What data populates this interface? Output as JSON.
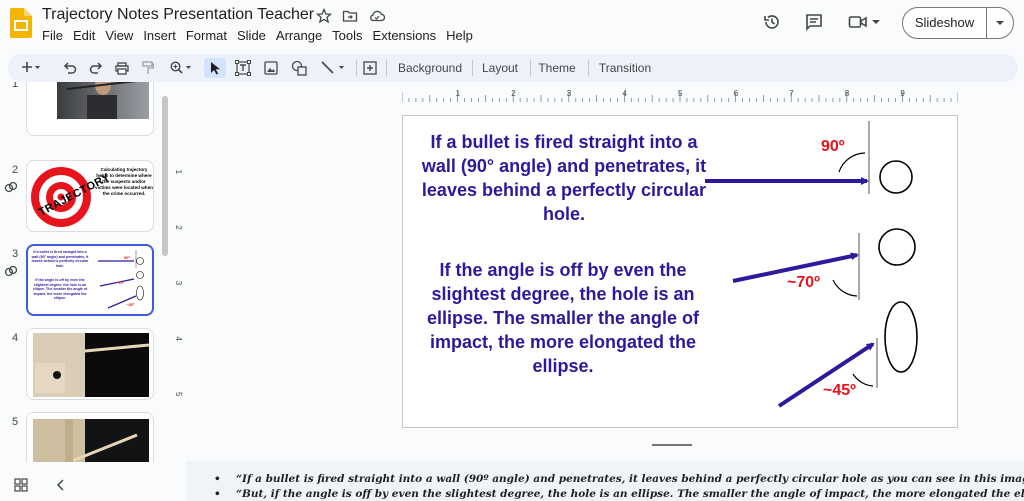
{
  "app": {
    "title": "Trajectory Notes Presentation Teacher",
    "menu": [
      "File",
      "Edit",
      "View",
      "Insert",
      "Format",
      "Slide",
      "Arrange",
      "Tools",
      "Extensions",
      "Help"
    ],
    "slideshow_label": "Slideshow"
  },
  "toolbar": {
    "background": "Background",
    "layout": "Layout",
    "theme": "Theme",
    "transition": "Transition"
  },
  "ruler": {
    "h_ticks": [
      "1",
      "2",
      "3",
      "4",
      "5",
      "6",
      "7",
      "8",
      "9"
    ],
    "v_ticks": [
      "1",
      "2",
      "3",
      "4",
      "5"
    ]
  },
  "filmstrip": {
    "slides": [
      {
        "num": "1"
      },
      {
        "num": "2",
        "title": "TRAJECTORY",
        "caption": "Calculating trajectory helps to determine where the suspects and/or victims were located when the crime occurred."
      },
      {
        "num": "3"
      },
      {
        "num": "4"
      },
      {
        "num": "5"
      }
    ]
  },
  "slide": {
    "text1": "If a bullet is fired straight into a wall (90° angle) and penetrates, it leaves behind a perfectly circular hole.",
    "text2": "If the angle is off by even the slightest degree, the hole is an ellipse. The smaller the angle of impact, the more elongated the ellipse.",
    "angle_90": "90º",
    "angle_70": "~70º",
    "angle_45": "~45º"
  },
  "notes": [
    "“If a bullet is fired straight into a wall (90º angle) and penetrates, it leaves behind a perfectly circular hole as you can see in this image.”",
    "“But, if the angle is off by even the slightest degree, the hole is an ellipse. The smaller the angle of impact, the more elongated the ellipse.”"
  ],
  "colors": {
    "slide_text": "#2b1a9b",
    "angle_label": "#e8141b",
    "accent": "#3c5cd8"
  }
}
